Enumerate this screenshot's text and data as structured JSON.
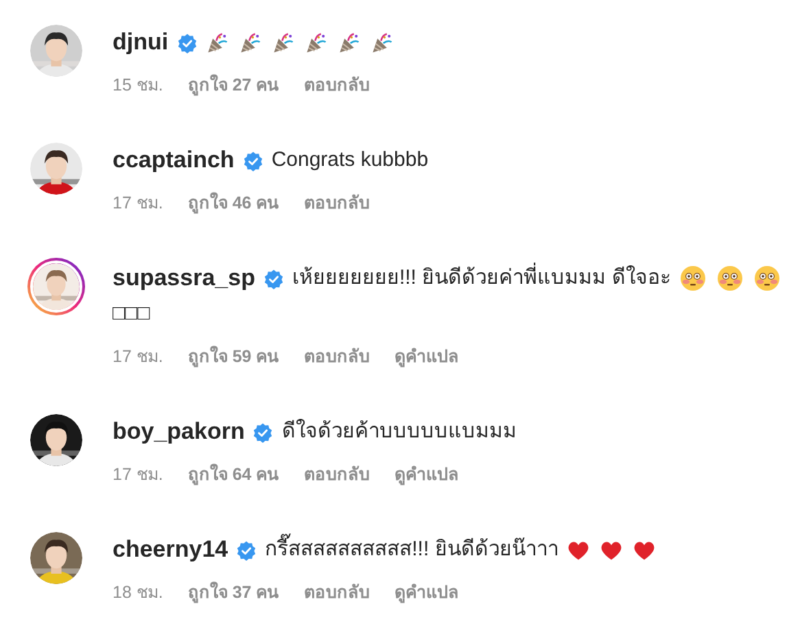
{
  "comments": [
    {
      "username": "djnui",
      "verified": true,
      "story_ring": false,
      "avatar": {
        "kind": "picture"
      },
      "parts": [
        {
          "kind": "party"
        },
        {
          "kind": "party"
        },
        {
          "kind": "party"
        },
        {
          "kind": "party"
        },
        {
          "kind": "party"
        },
        {
          "kind": "party"
        }
      ],
      "time": "15 ชม.",
      "likes": "ถูกใจ 27 คน",
      "reply": "ตอบกลับ"
    },
    {
      "username": "ccaptainch",
      "verified": true,
      "story_ring": false,
      "avatar": {
        "kind": "picture"
      },
      "parts": [
        {
          "kind": "text",
          "text": "Congrats kubbbb"
        }
      ],
      "time": "17 ชม.",
      "likes": "ถูกใจ 46 คน",
      "reply": "ตอบกลับ"
    },
    {
      "username": "supassra_sp",
      "verified": true,
      "story_ring": true,
      "avatar": {
        "kind": "picture"
      },
      "parts": [
        {
          "kind": "text",
          "text": "เห้ยยยยยยย!!! ยินดีด้วยค่าพี่แบมมม ดีใจอะ"
        },
        {
          "kind": "flushed"
        },
        {
          "kind": "flushed"
        },
        {
          "kind": "flushed"
        },
        {
          "kind": "text",
          "text": "□□□"
        }
      ],
      "time": "17 ชม.",
      "likes": "ถูกใจ 59 คน",
      "reply": "ตอบกลับ",
      "translate": "ดูคำแปล"
    },
    {
      "username": "boy_pakorn",
      "verified": true,
      "story_ring": false,
      "avatar": {
        "kind": "picture"
      },
      "parts": [
        {
          "kind": "text",
          "text": "ดีใจด้วยค้าบบบบบแบมมม"
        }
      ],
      "time": "17 ชม.",
      "likes": "ถูกใจ 64 คน",
      "reply": "ตอบกลับ",
      "translate": "ดูคำแปล"
    },
    {
      "username": "cheerny14",
      "verified": true,
      "story_ring": false,
      "avatar": {
        "kind": "picture"
      },
      "parts": [
        {
          "kind": "text",
          "text": "กรี๊สสสสสสสสสส!!! ยินดีด้วยน๊าาา"
        },
        {
          "kind": "heart"
        },
        {
          "kind": "heart"
        },
        {
          "kind": "heart"
        }
      ],
      "time": "18 ชม.",
      "likes": "ถูกใจ 37 คน",
      "reply": "ตอบกลับ",
      "translate": "ดูคำแปล"
    }
  ]
}
